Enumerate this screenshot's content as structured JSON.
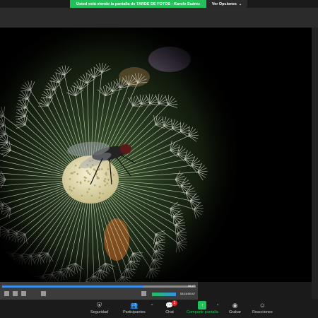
{
  "banner": {
    "text": "Usted está viendo la pantalla de TARDE DE FOTOS - Karolo Suárez",
    "options_label": "Ver Opciones"
  },
  "player": {
    "elapsed": "05:47",
    "counter": "03:16:50:47",
    "progress": 0.73
  },
  "toolbar": {
    "security": "Seguridad",
    "participants": "Participantes",
    "participants_count": "27",
    "chat": "Chat",
    "chat_badge": "1",
    "share": "Compartir pantalla",
    "record": "Grabar",
    "reactions": "Reacciones"
  },
  "icons": {
    "security": "shield-icon",
    "participants": "people-icon",
    "chat": "chat-icon",
    "share": "share-screen-icon",
    "record": "record-icon",
    "reactions": "smiley-icon"
  },
  "colors": {
    "banner_green": "#21c25a",
    "badge_red": "#e02828",
    "progress_blue": "#3a8ee6"
  }
}
